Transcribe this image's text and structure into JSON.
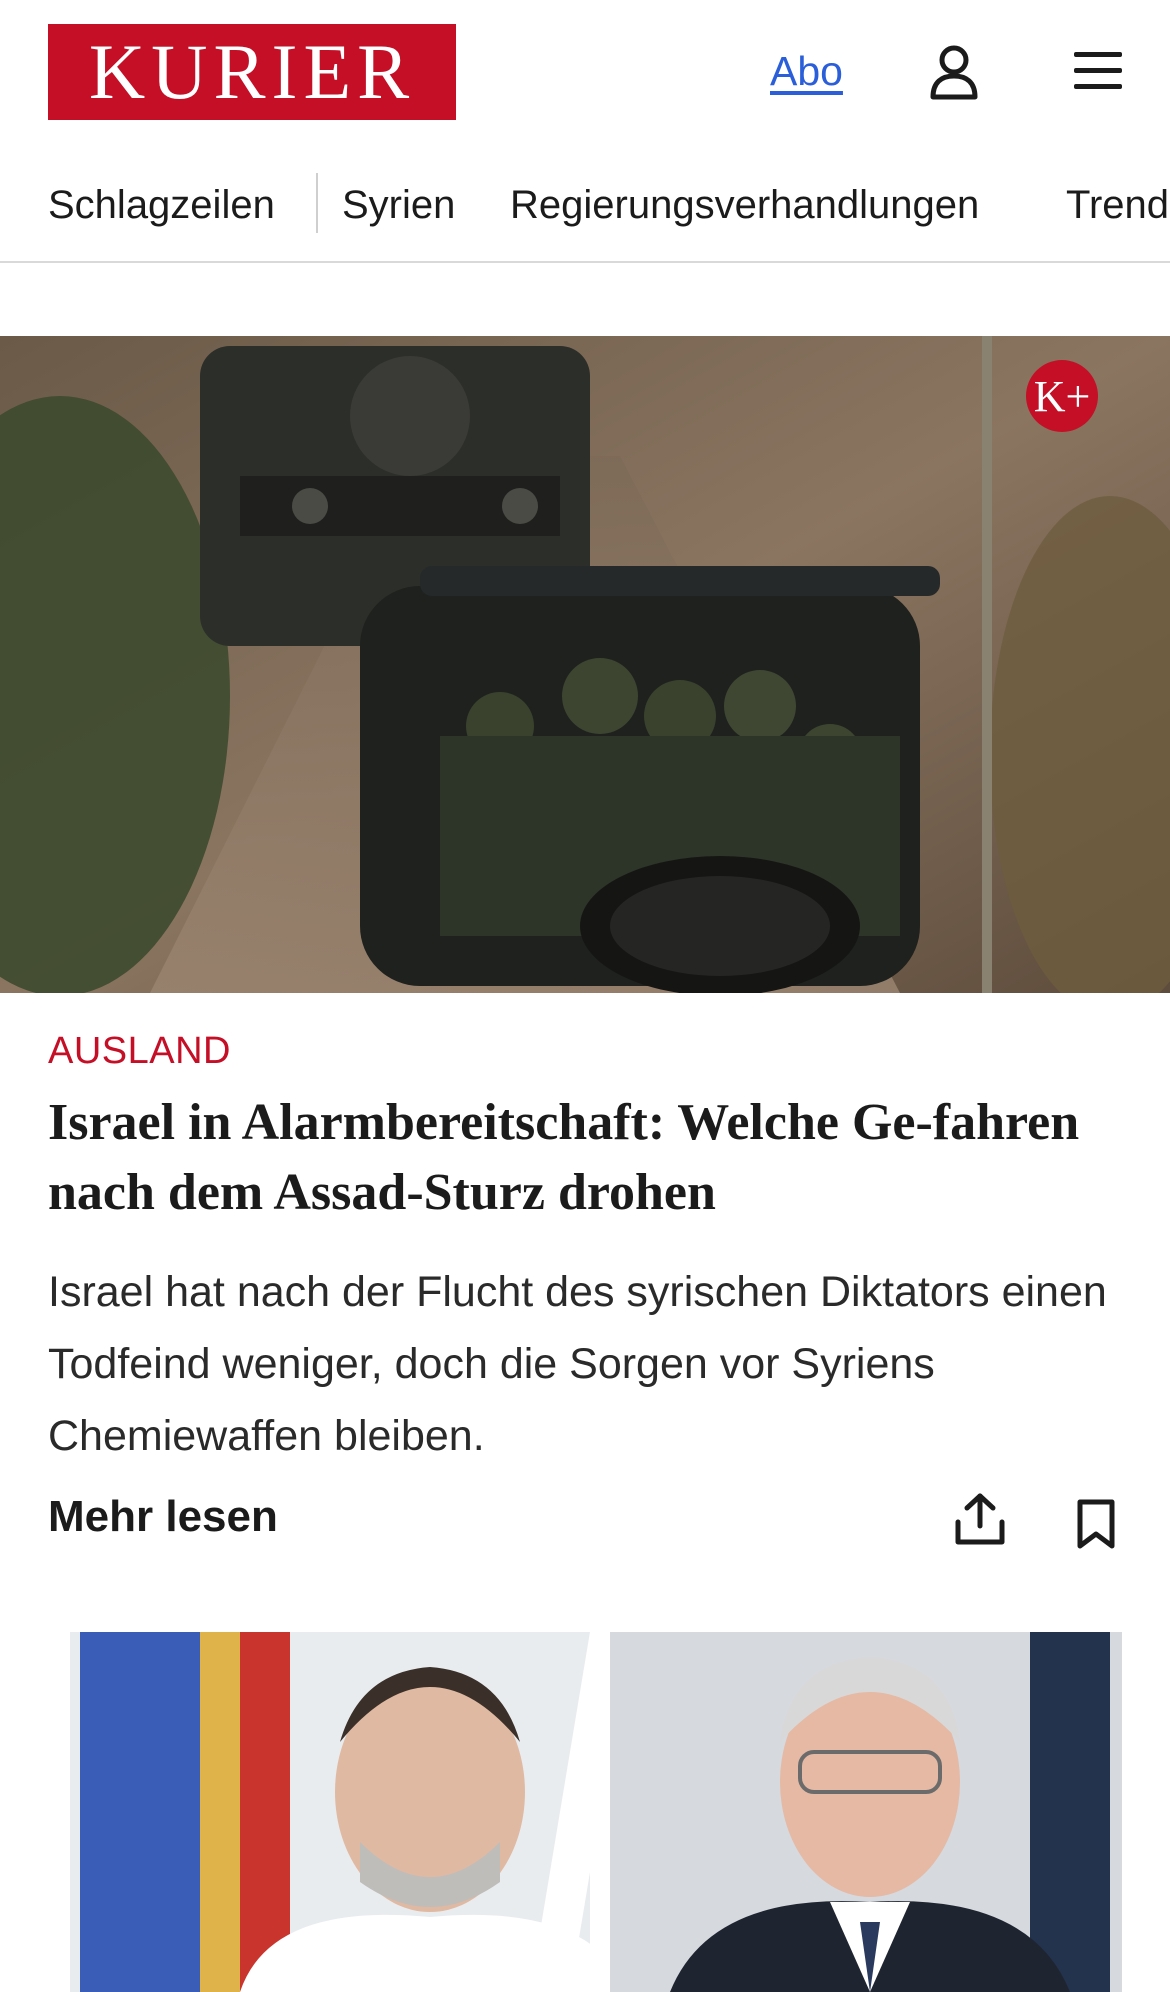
{
  "header": {
    "logo_text": "KURIER",
    "abo_label": "Abo",
    "user_icon": "user-icon",
    "menu_icon": "hamburger-menu-icon"
  },
  "nav": {
    "items": [
      "Schlagzeilen",
      "Syrien",
      "Regierungsverhandlungen",
      "Trend"
    ]
  },
  "article": {
    "badge": "K+",
    "category": "AUSLAND",
    "headline": "Israel in Alarmbereitschaft: Welche Ge-fahren nach dem Assad-Sturz drohen",
    "teaser": "Israel hat nach der Flucht des syrischen Diktators einen Todfeind weniger, doch die Sorgen vor Syriens Chemiewaffen bleiben.",
    "more_label": "Mehr lesen",
    "share_icon": "share-icon",
    "bookmark_icon": "bookmark-icon"
  },
  "colors": {
    "brand_red": "#c40f26",
    "link_blue": "#2b5fd9",
    "text_dark": "#1b1b1b"
  }
}
